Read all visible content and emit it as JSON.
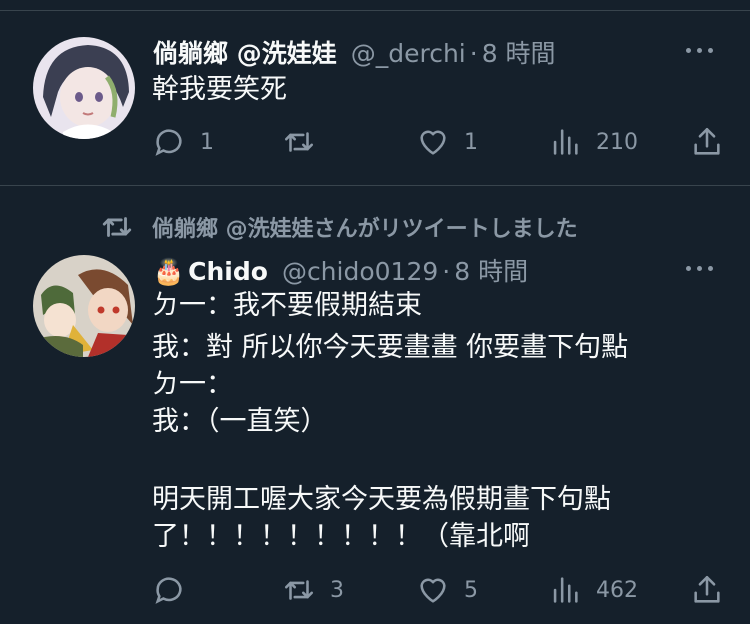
{
  "tweets": [
    {
      "display_name": "倘躺鄉 @洗娃娃",
      "handle": "@_derchi",
      "separator": "·",
      "time": "8 時間",
      "text": "幹我要笑死",
      "stats": {
        "reply": "1",
        "retweet": "",
        "like": "1",
        "views": "210"
      }
    },
    {
      "retweet_banner": "倘躺鄉 @洗娃娃さんがリツイートしました",
      "display_name_emoji": "🎂",
      "display_name": "Chido",
      "handle": "@chido0129",
      "separator": "·",
      "time": "8 時間",
      "text_lines": [
        "ㄉ一：我不要假期結束",
        "我：對 所以你今天要畫畫 你要畫下句點",
        "ㄉ一：",
        "我：（一直笑）",
        "",
        "明天開工喔大家今天要為假期畫下句點",
        "了！！！！！！！！！（靠北啊"
      ],
      "stats": {
        "reply": "",
        "retweet": "3",
        "like": "5",
        "views": "462"
      }
    }
  ],
  "colors": {
    "background": "#15202b",
    "text": "#f7f9f9",
    "secondary": "#8b98a5",
    "divider": "#38444d"
  },
  "icons": [
    "reply-icon",
    "retweet-icon",
    "like-icon",
    "views-icon",
    "share-icon",
    "more-icon"
  ]
}
